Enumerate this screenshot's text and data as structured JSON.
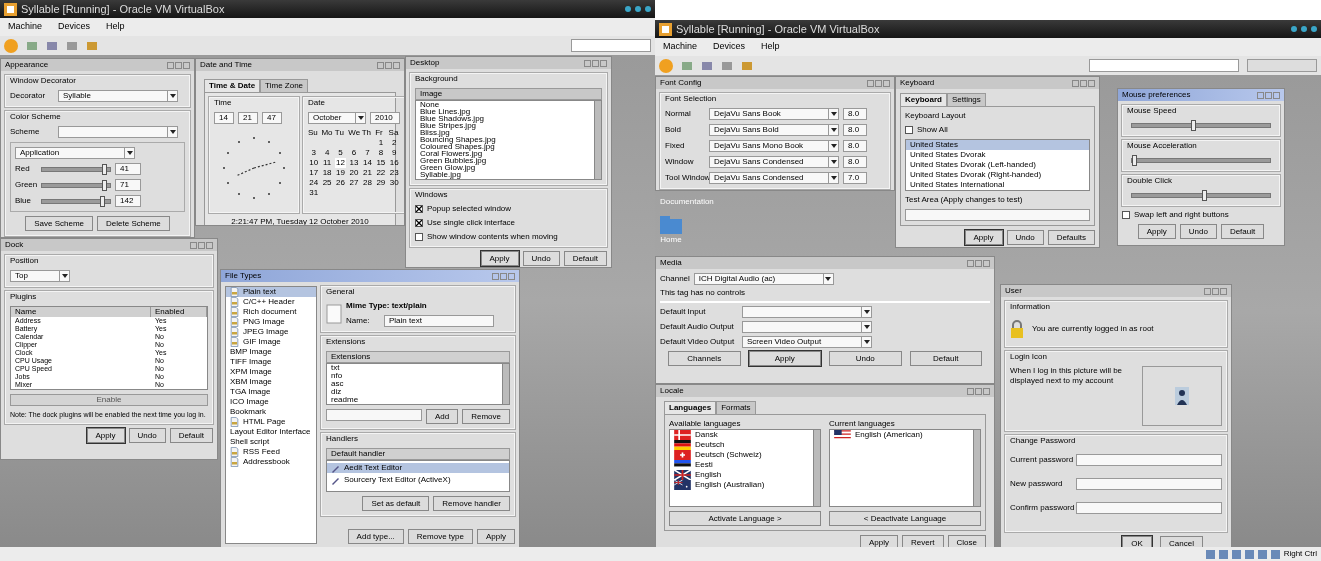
{
  "vms": [
    {
      "title": "Syllable [Running] - Oracle VM VirtualBox",
      "menus": [
        "Machine",
        "Devices",
        "Help"
      ],
      "windows": [
        {
          "kind": "appearance",
          "title": "Appearance",
          "focused": false,
          "decorator_group": "Window Decorator",
          "decorator_label": "Decorator",
          "decorator_value": "Syllable",
          "scheme_group": "Color Scheme",
          "scheme_label": "Scheme",
          "element": "Application",
          "sliders": [
            {
              "label": "Red",
              "level": 0.92,
              "value": "41"
            },
            {
              "label": "Green",
              "level": 0.92,
              "value": "71"
            },
            {
              "label": "Blue",
              "level": 0.9,
              "value": "142"
            }
          ],
          "buttons": [
            "Save Scheme",
            "Delete Scheme"
          ]
        },
        {
          "kind": "datetime",
          "title": "Date and Time",
          "focused": false,
          "tabs": [
            {
              "label": "Time & Date",
              "selected": true
            },
            {
              "label": "Time Zone",
              "selected": false
            }
          ],
          "time_group": "Time",
          "hour": "14",
          "minute": "21",
          "second": "47",
          "date_group": "Date",
          "month": "October",
          "year": "2010",
          "weekdays": [
            "Su",
            "Mo",
            "Tu",
            "We",
            "Th",
            "Fr",
            "Sa"
          ],
          "weeks": [
            {
              "starts_midweek": true,
              "days": [
                {
                  "d": "1",
                  "selected": false
                },
                {
                  "d": "2",
                  "selected": false
                }
              ]
            },
            {
              "days": [
                {
                  "d": "3",
                  "selected": false
                },
                {
                  "d": "4",
                  "selected": false
                },
                {
                  "d": "5",
                  "selected": false
                },
                {
                  "d": "6",
                  "selected": false
                },
                {
                  "d": "7",
                  "selected": false
                },
                {
                  "d": "8",
                  "selected": false
                },
                {
                  "d": "9",
                  "selected": false
                }
              ]
            },
            {
              "days": [
                {
                  "d": "10",
                  "selected": false
                },
                {
                  "d": "11",
                  "selected": false
                },
                {
                  "d": "12",
                  "selected": true
                },
                {
                  "d": "13",
                  "selected": false
                },
                {
                  "d": "14",
                  "selected": false
                },
                {
                  "d": "15",
                  "selected": false
                },
                {
                  "d": "16",
                  "selected": false
                }
              ]
            },
            {
              "days": [
                {
                  "d": "17",
                  "selected": false
                },
                {
                  "d": "18",
                  "selected": false
                },
                {
                  "d": "19",
                  "selected": false
                },
                {
                  "d": "20",
                  "selected": false
                },
                {
                  "d": "21",
                  "selected": false
                },
                {
                  "d": "22",
                  "selected": false
                },
                {
                  "d": "23",
                  "selected": false
                }
              ]
            },
            {
              "days": [
                {
                  "d": "24",
                  "selected": false
                },
                {
                  "d": "25",
                  "selected": false
                },
                {
                  "d": "26",
                  "selected": false
                },
                {
                  "d": "27",
                  "selected": false
                },
                {
                  "d": "28",
                  "selected": false
                },
                {
                  "d": "29",
                  "selected": false
                },
                {
                  "d": "30",
                  "selected": false
                }
              ]
            },
            {
              "days": [
                {
                  "d": "31",
                  "selected": false
                }
              ]
            }
          ],
          "status": "2:21:47 PM, Tuesday 12 October 2010"
        },
        {
          "kind": "desktop",
          "title": "Desktop",
          "focused": false,
          "background_group": "Background",
          "column": "Image",
          "items": [
            "None",
            "Blue Lines.jpg",
            "Blue Shadows.jpg",
            "Blue Stripes.jpg",
            "Bliss.jpg",
            "Bouncing Shapes.jpg",
            "Coloured Shapes.jpg",
            "Coral Flowers.jpg",
            "Green Bubbles.jpg",
            "Green Glow.jpg",
            "Syllable.jpg"
          ],
          "windows_group": "Windows",
          "checks": [
            {
              "label": "Popup selected window",
              "checked": true
            },
            {
              "label": "Use single click interface",
              "checked": true
            },
            {
              "label": "Show window contents when moving",
              "checked": false
            }
          ],
          "buttons": [
            "Apply",
            "Undo",
            "Default"
          ]
        },
        {
          "kind": "dock",
          "title": "Dock",
          "focused": false,
          "position_group": "Position",
          "position": "Top",
          "plugins_group": "Plugins",
          "columns": [
            "Name",
            "Enabled"
          ],
          "rows": [
            [
              "Address",
              "Yes"
            ],
            [
              "Battery",
              "Yes"
            ],
            [
              "Calendar",
              "No"
            ],
            [
              "Clipper",
              "No"
            ],
            [
              "Clock",
              "Yes"
            ],
            [
              "CPU Usage",
              "No"
            ],
            [
              "CPU Speed",
              "No"
            ],
            [
              "Jobs",
              "No"
            ],
            [
              "Mixer",
              "No"
            ]
          ],
          "toggle": "Enable",
          "note": "Note: The dock plugins will be enabled the next time you log in.",
          "buttons": [
            "Apply",
            "Undo",
            "Default"
          ]
        },
        {
          "kind": "filetypes",
          "title": "File Types",
          "focused": true,
          "types": [
            {
              "label": "Plain text",
              "icon": true,
              "selected": true
            },
            {
              "label": "C/C++ Header",
              "icon": true,
              "selected": false
            },
            {
              "label": "Rich document",
              "icon": true,
              "selected": false
            },
            {
              "label": "PNG Image",
              "icon": true,
              "selected": false
            },
            {
              "label": "JPEG Image",
              "icon": true,
              "selected": false
            },
            {
              "label": "GIF Image",
              "icon": true,
              "selected": false
            },
            {
              "label": "BMP Image",
              "icon": false,
              "selected": false
            },
            {
              "label": "TIFF Image",
              "icon": false,
              "selected": false
            },
            {
              "label": "XPM Image",
              "icon": false,
              "selected": false
            },
            {
              "label": "XBM Image",
              "icon": false,
              "selected": false
            },
            {
              "label": "TGA Image",
              "icon": false,
              "selected": false
            },
            {
              "label": "ICO Image",
              "icon": false,
              "selected": false
            },
            {
              "label": "Bookmark",
              "icon": false,
              "selected": false
            },
            {
              "label": "HTML Page",
              "icon": true,
              "selected": false
            },
            {
              "label": "Layout Editor Interface",
              "icon": false,
              "selected": false
            },
            {
              "label": "Shell script",
              "icon": false,
              "selected": false
            },
            {
              "label": "RSS Feed",
              "icon": true,
              "selected": false
            },
            {
              "label": "Addressbook",
              "icon": true,
              "selected": false
            }
          ],
          "general_group": "General",
          "mime": "Mime Type: text/plain",
          "name_label": "Name:",
          "name_value": "Plain text",
          "ext_group": "Extensions",
          "ext_column": "Extensions",
          "extensions": [
            "txt",
            "nfo",
            "asc",
            "diz",
            "readme"
          ],
          "ext_buttons": [
            "Add",
            "Remove"
          ],
          "handlers_group": "Handlers",
          "handlers_column": "Default handler",
          "handlers": [
            {
              "label": "Aedit Text Editor",
              "selected": true
            },
            {
              "label": "Sourcery Text Editor (ActiveX)",
              "selected": false
            }
          ],
          "handler_buttons": [
            "Set as default",
            "Remove handler"
          ],
          "buttons": [
            "Add type...",
            "Remove type",
            "Apply"
          ]
        }
      ]
    },
    {
      "title": "Syllable [Running] - Oracle VM VirtualBox",
      "menus": [
        "Machine",
        "Devices",
        "Help"
      ],
      "host_key": "Right Ctrl",
      "desktop_icons": [
        {
          "label": "Documentation",
          "kind": "text"
        },
        {
          "label": "Home",
          "kind": "folder"
        }
      ],
      "windows": [
        {
          "kind": "fonts",
          "title": "Font Config",
          "focused": false,
          "group": "Font Selection",
          "rows": [
            {
              "label": "Normal",
              "font": "DejaVu Sans Book",
              "size": "8.0"
            },
            {
              "label": "Bold",
              "font": "DejaVu Sans Bold",
              "size": "8.0"
            },
            {
              "label": "Fixed",
              "font": "DejaVu Sans Mono Book",
              "size": "8.0"
            },
            {
              "label": "Window",
              "font": "DejaVu Sans Condensed",
              "size": "8.0"
            },
            {
              "label": "Tool Window",
              "font": "DejaVu Sans Condensed",
              "size": "7.0"
            }
          ]
        },
        {
          "kind": "keyboard",
          "title": "Keyboard",
          "focused": false,
          "tabs": [
            {
              "label": "Keyboard",
              "selected": true
            },
            {
              "label": "Settings",
              "selected": false
            }
          ],
          "layout_label": "Keyboard Layout",
          "show_all": {
            "label": "Show All",
            "checked": false
          },
          "layouts": [
            {
              "label": "United States",
              "selected": true
            },
            {
              "label": "United States Dvorak",
              "selected": false
            },
            {
              "label": "United States Dvorak (Left-handed)",
              "selected": false
            },
            {
              "label": "United States Dvorak (Right-handed)",
              "selected": false
            },
            {
              "label": "United States International",
              "selected": false
            }
          ],
          "test_label": "Test Area (Apply changes to test)",
          "buttons": [
            "Apply",
            "Undo",
            "Defaults"
          ]
        },
        {
          "kind": "mouse",
          "title": "Mouse preferences",
          "focused": true,
          "sliders": [
            {
              "label": "Mouse Speed",
              "level": 0.45
            },
            {
              "label": "Mouse Acceleration",
              "level": 0.02
            },
            {
              "label": "Double Click",
              "level": 0.53
            }
          ],
          "swap": {
            "label": "Swap left and right buttons",
            "checked": false
          },
          "buttons": [
            "Apply",
            "Undo",
            "Default"
          ]
        },
        {
          "kind": "media",
          "title": "Media",
          "focused": false,
          "channel_label": "Channel",
          "channel": "ICH Digital Audio (ac)",
          "note": "This tag has no controls",
          "rows": [
            {
              "label": "Default Input"
            },
            {
              "label": "Default Audio Output"
            },
            {
              "label": "Default Video Output",
              "value": "Screen Video Output"
            }
          ],
          "buttons": [
            "Channels",
            "Apply",
            "Undo",
            "Default"
          ]
        },
        {
          "kind": "locale",
          "title": "Locale",
          "focused": false,
          "tabs": [
            {
              "label": "Languages",
              "selected": true
            },
            {
              "label": "Formats",
              "selected": false
            }
          ],
          "available_label": "Available languages",
          "current_label": "Current languages",
          "available": [
            {
              "label": "Dansk",
              "kind": "cross"
            },
            {
              "label": "Deutsch",
              "kind": "bands"
            },
            {
              "label": "Deutsch (Schweiz)",
              "kind": "swiss"
            },
            {
              "label": "Eesti",
              "kind": "bands-blue"
            },
            {
              "label": "English",
              "kind": "union"
            },
            {
              "label": "English (Australian)",
              "kind": "union-stars"
            }
          ],
          "current": [
            {
              "label": "English (American)",
              "kind": "stripes"
            }
          ],
          "activate": "Activate Language >",
          "deactivate": "< Deactivate Language",
          "buttons": [
            "Apply",
            "Revert",
            "Close"
          ]
        },
        {
          "kind": "users",
          "title": "User",
          "focused": false,
          "info_group": "Information",
          "info": "You are currently logged in as root",
          "icon_group": "Login Icon",
          "icon_text": "When I log in this picture will be displayed next to my account",
          "password_group": "Change Password",
          "fields": [
            "Current password",
            "New password",
            "Confirm password"
          ],
          "buttons": [
            "OK",
            "Cancel"
          ]
        }
      ]
    }
  ]
}
